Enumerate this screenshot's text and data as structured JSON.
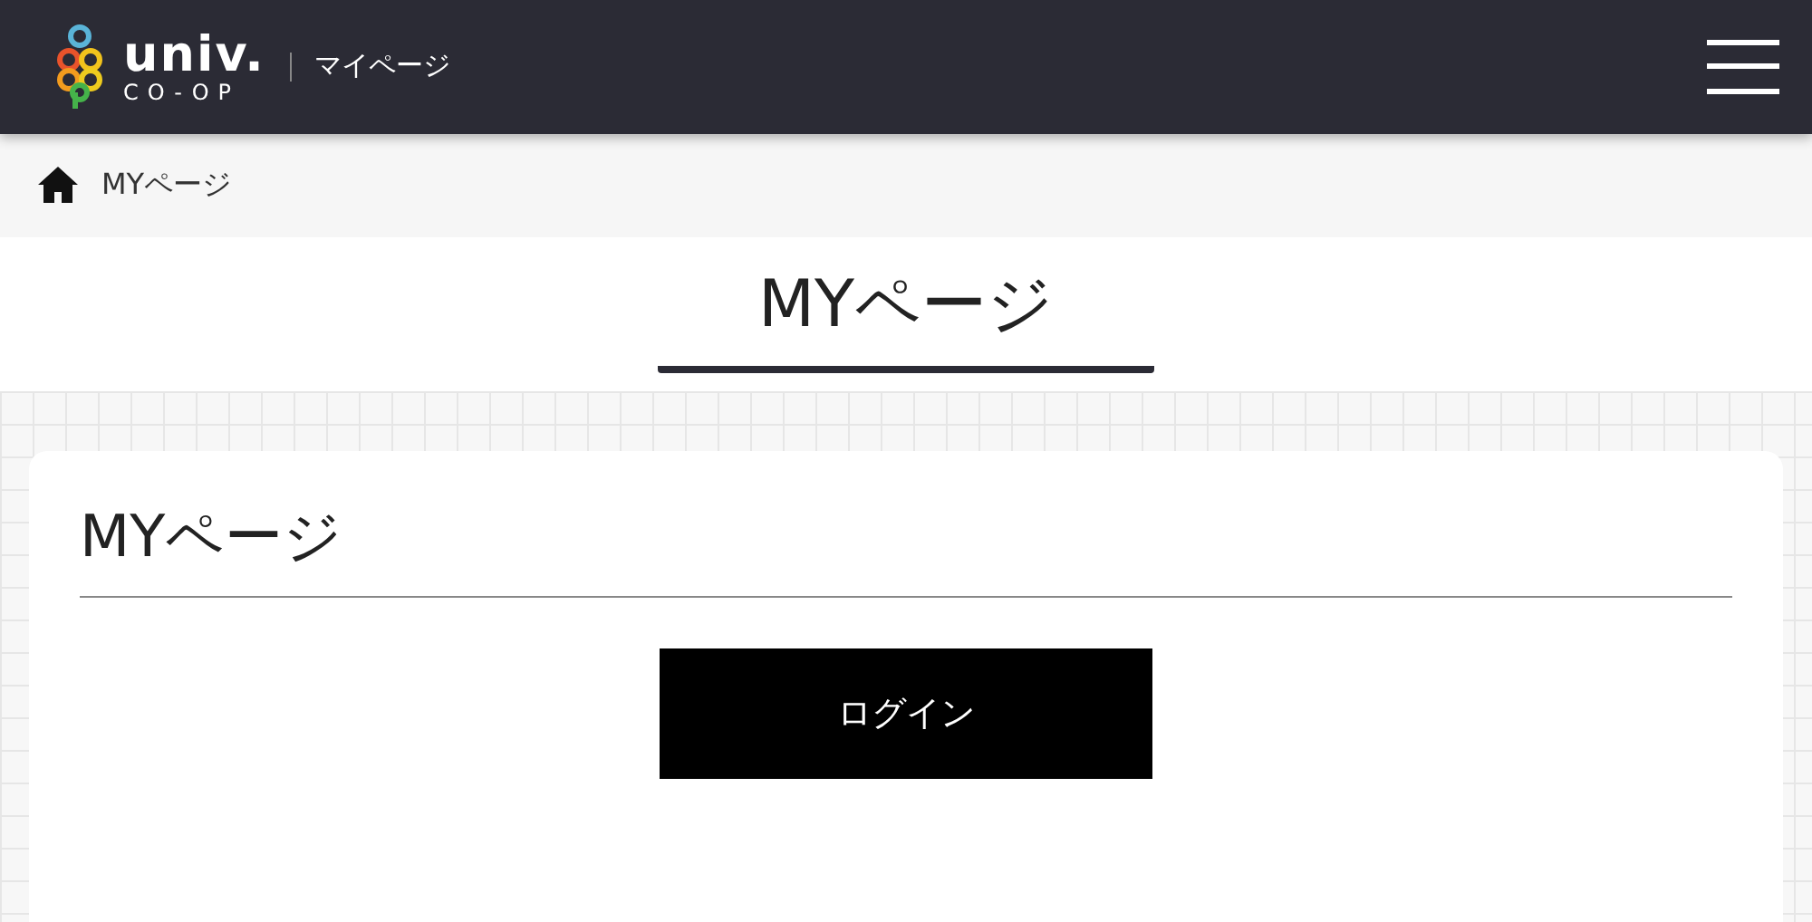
{
  "header": {
    "logo_main": "univ.",
    "logo_sub": "CO-OP",
    "site_title": "マイページ"
  },
  "breadcrumb": [
    {
      "label": "MYページ"
    }
  ],
  "page_title": "MYページ",
  "card": {
    "heading": "MYページ",
    "buttons": [
      {
        "label": "ログイン"
      }
    ]
  }
}
